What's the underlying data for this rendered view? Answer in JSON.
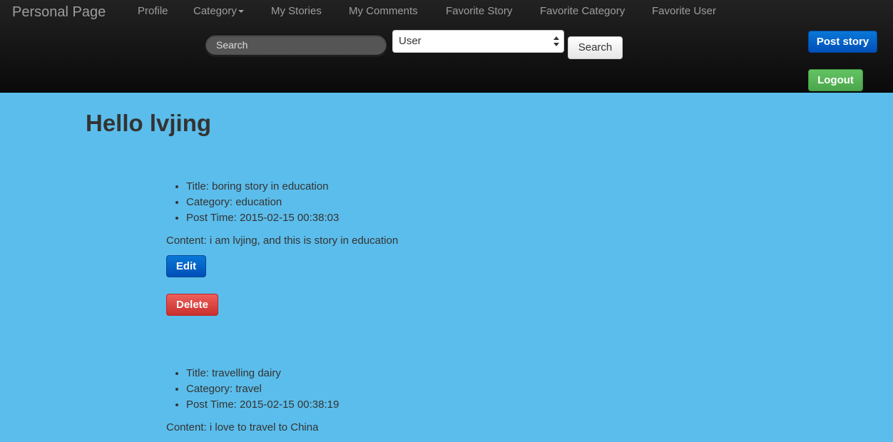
{
  "navbar": {
    "brand": "Personal Page",
    "links": [
      {
        "label": "Profile"
      },
      {
        "label": "Category"
      },
      {
        "label": "My Stories"
      },
      {
        "label": "My Comments"
      },
      {
        "label": "Favorite Story"
      },
      {
        "label": "Favorite Category"
      },
      {
        "label": "Favorite User"
      }
    ],
    "search_placeholder": "Search",
    "search_type_selected": "User",
    "search_button": "Search",
    "post_story_button": "Post story",
    "logout_button": "Logout"
  },
  "main": {
    "greeting": "Hello lvjing",
    "stories": [
      {
        "title": "Title: boring story in education",
        "category": "Category: education",
        "post_time": "Post Time: 2015-02-15 00:38:03",
        "content": "Content: i am lvjing, and this is story in education",
        "edit_label": "Edit",
        "delete_label": "Delete"
      },
      {
        "title": "Title: travelling dairy",
        "category": "Category: travel",
        "post_time": "Post Time: 2015-02-15 00:38:19",
        "content": "Content: i love to travel to China"
      }
    ]
  },
  "colors": {
    "background": "#5bbdeb",
    "navbar": "#111111",
    "primary": "#0063cc",
    "success": "#5cb85c",
    "danger": "#d9534f"
  }
}
